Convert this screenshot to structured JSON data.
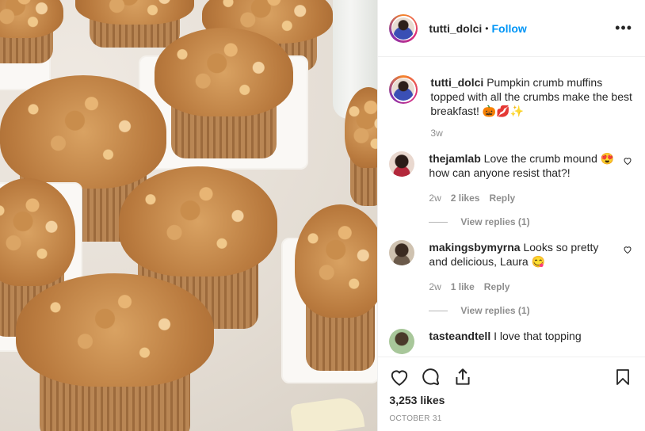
{
  "header": {
    "username": "tutti_dolci",
    "separator": "•",
    "follow_label": "Follow",
    "more_label": "•••"
  },
  "caption": {
    "username": "tutti_dolci",
    "text": "Pumpkin crumb muffins topped with all the crumbs make the best breakfast! 🎃💋✨",
    "time": "3w"
  },
  "comments": [
    {
      "username": "thejamlab",
      "text_before": "Love the crumb mound ",
      "emoji": "😍",
      "text_after": " how can anyone resist that?!",
      "time": "2w",
      "likes": "2 likes",
      "reply_label": "Reply",
      "view_replies": "View replies (1)"
    },
    {
      "username": "makingsbymyrna",
      "text_before": "Looks so pretty and delicious, Laura ",
      "emoji": "😋",
      "text_after": "",
      "time": "2w",
      "likes": "1 like",
      "reply_label": "Reply",
      "view_replies": "View replies (1)"
    },
    {
      "username": "tasteandtell",
      "text_before": "I love that topping",
      "emoji": "",
      "text_after": ""
    }
  ],
  "actions": {
    "likes": "3,253 likes",
    "date": "OCTOBER 31"
  },
  "colors": {
    "accent": "#0095f6",
    "muted": "#8e8e8e",
    "text": "#262626"
  },
  "icons": [
    "heart-icon",
    "comment-icon",
    "share-icon",
    "bookmark-icon",
    "more-icon"
  ]
}
